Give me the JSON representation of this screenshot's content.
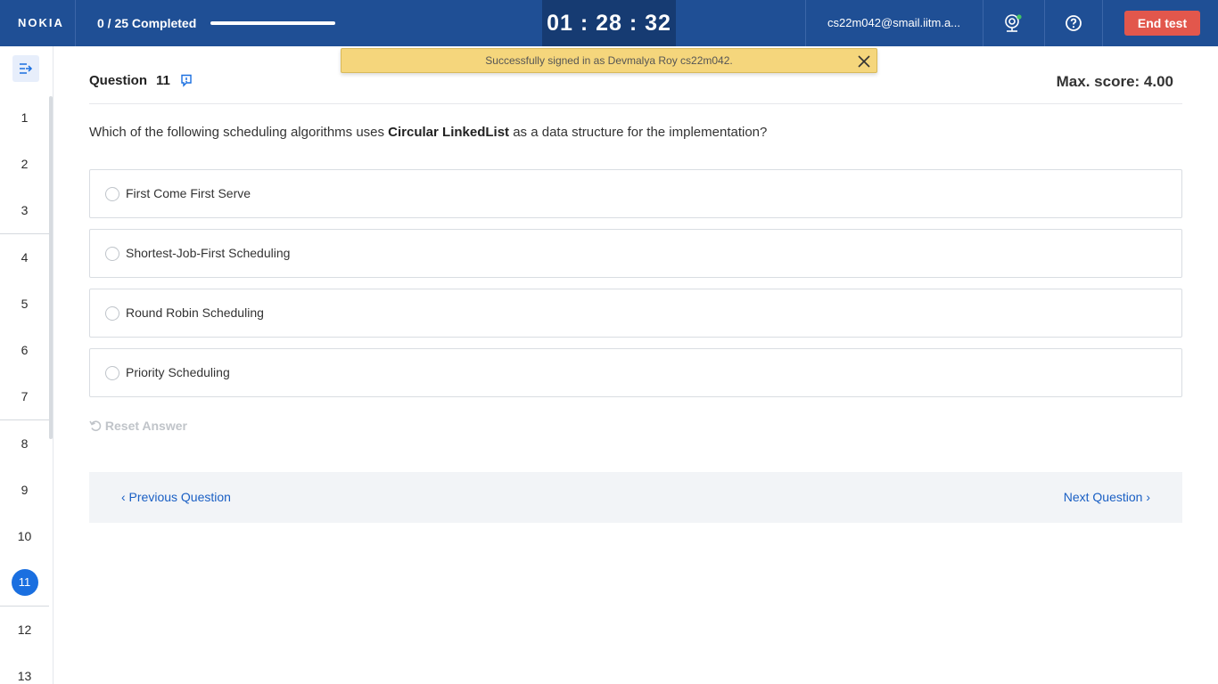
{
  "header": {
    "logo": "NOKIA",
    "progress_text": "0 / 25 Completed",
    "progress_fraction": 0,
    "timer": "01 : 28 : 32",
    "user_email": "cs22m042@smail.iitm.a...",
    "end_test_label": "End test"
  },
  "toast": {
    "message": "Successfully signed in as Devmalya Roy cs22m042."
  },
  "sidebar": {
    "questions": [
      "1",
      "2",
      "3",
      "4",
      "5",
      "6",
      "7",
      "8",
      "9",
      "10",
      "11",
      "12",
      "13"
    ],
    "active": "11"
  },
  "question": {
    "label": "Question",
    "number": "11",
    "max_score": "Max. score: 4.00",
    "text_before": "Which of the following scheduling algorithms uses ",
    "text_bold": "Circular LinkedList",
    "text_after": " as a data structure for the implementation?",
    "options": [
      "First Come First Serve",
      "Shortest-Job-First Scheduling",
      "Round Robin Scheduling",
      "Priority Scheduling"
    ],
    "reset_label": "Reset Answer"
  },
  "navigation": {
    "previous_label": "‹ Previous Question",
    "next_label": "Next Question ›"
  },
  "colors": {
    "topbar": "#1f4f95",
    "accent": "#1a6fe0",
    "end_button": "#e2574c",
    "toast": "#f5d67c"
  }
}
